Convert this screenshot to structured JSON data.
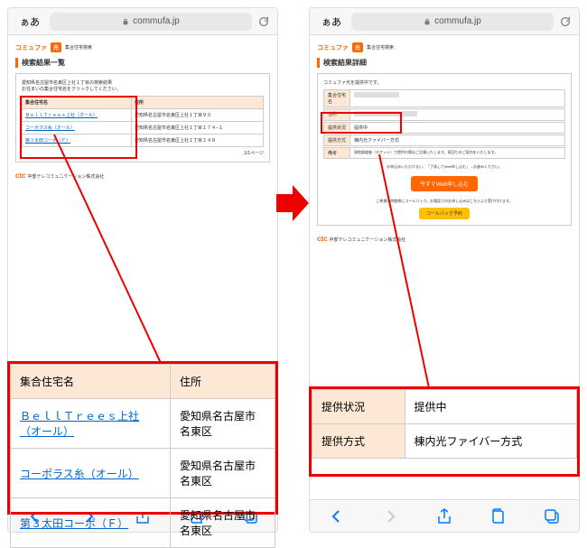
{
  "browser": {
    "aa": "ぁあ",
    "domain": "commufa.jp"
  },
  "logo": {
    "brand": "コミュファ",
    "badge": "光",
    "sub": "集合住宅検索"
  },
  "left": {
    "title": "検索結果一覧",
    "note": "愛知県名古屋市名東区上社１丁目の検索結果\nお住まいの集合住宅名をクリックしてください。",
    "headers": {
      "name": "集合住宅名",
      "addr": "住所"
    },
    "rows": [
      {
        "name": "ＢｅｌｌＴｒｅｅｓ上社（オール）",
        "addr": "愛知県名古屋市名東区上社１丁目９０"
      },
      {
        "name": "コーポラス糸（オール）",
        "addr": "愛知県名古屋市名東区上社１丁目１７４−１"
      },
      {
        "name": "第３太田コーポ（Ｆ）",
        "addr": "愛知県名古屋市名東区上社１丁目２４８"
      }
    ],
    "page": "1/1ページ"
  },
  "right": {
    "title": "検索結果詳細",
    "note": "コミュファ光を提供中です。",
    "labels": {
      "name": "集合住宅名",
      "addr": "住所",
      "status": "提供状況",
      "method": "提供方式",
      "remark": "備考"
    },
    "values": {
      "status": "提供中",
      "method": "棟内光ファイバー方式",
      "remark": "現地調査後（チケット）で提供の際はご注意いたします。導回りのご案内をいたします。"
    },
    "cta": "今すぐWeb申し込む",
    "cta_note": "お申込みいただけない、「了承してWeb申し込む」→お進みください。",
    "callback": "コールバック予約",
    "callback_note": "ご希望の時間帯にコールバック。お電話でのお申し込みはこちらより受け付けます。"
  },
  "zoom_left": {
    "headers": {
      "name": "集合住宅名",
      "addr": "住所"
    },
    "rows": [
      {
        "name": "ＢｅｌｌＴｒｅｅｓ上社（オール）",
        "addr": "愛知県名古屋市名東区"
      },
      {
        "name": "コーポラス糸（オール）",
        "addr": "愛知県名古屋市名東区"
      },
      {
        "name": "第３太田コーポ（Ｆ）",
        "addr": "愛知県名古屋市名東区"
      }
    ]
  },
  "zoom_right": {
    "rows": [
      {
        "label": "提供状況",
        "value": "提供中"
      },
      {
        "label": "提供方式",
        "value": "棟内光ファイバー方式"
      }
    ]
  },
  "ctc": {
    "brand": "ctc",
    "company": "中部テレコミュニケーション株式会社"
  }
}
